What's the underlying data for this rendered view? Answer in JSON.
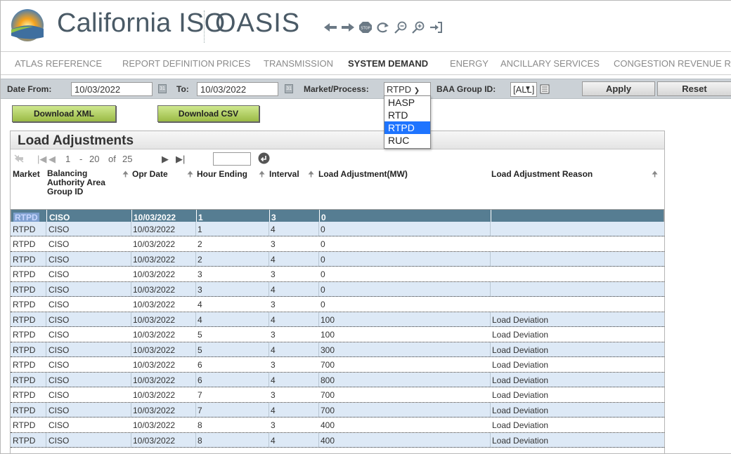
{
  "header": {
    "brand": "California ISO",
    "app": "OASIS",
    "tool_icons": [
      "arrow-left-icon",
      "arrow-right-icon",
      "stop-icon",
      "refresh-icon",
      "zoom-out-icon",
      "zoom-in-icon",
      "logout-icon"
    ]
  },
  "nav": {
    "items": [
      {
        "label": "ATLAS REFERENCE",
        "active": false
      },
      {
        "label": "REPORT DEFINITION",
        "active": false
      },
      {
        "label": "PRICES",
        "active": false
      },
      {
        "label": "TRANSMISSION",
        "active": false
      },
      {
        "label": "SYSTEM DEMAND",
        "active": true
      },
      {
        "label": "ENERGY",
        "active": false
      },
      {
        "label": "ANCILLARY SERVICES",
        "active": false
      },
      {
        "label": "CONGESTION REVENUE RI",
        "active": false
      }
    ]
  },
  "filter": {
    "date_from_label": "Date From:",
    "date_from_value": "10/03/2022",
    "to_label": "To:",
    "to_value": "10/03/2022",
    "market_label": "Market/Process:",
    "market_value": "RTPD",
    "baa_label": "BAA Group ID:",
    "baa_value": "[ALL]",
    "apply_label": "Apply",
    "reset_label": "Reset"
  },
  "market_options": [
    {
      "label": "HASP",
      "highlighted": false
    },
    {
      "label": "RTD",
      "highlighted": false
    },
    {
      "label": "RTPD",
      "highlighted": true
    },
    {
      "label": "RUC",
      "highlighted": false
    }
  ],
  "download": {
    "xml_label": "Download XML",
    "csv_label": "Download CSV"
  },
  "table": {
    "title": "Load Adjustments",
    "pager": {
      "from": "1",
      "dash": "-",
      "to": "20",
      "of_label": "of",
      "total": "25"
    },
    "columns": {
      "market": "Market",
      "baa": "Balancing Authority Area Group ID",
      "opr_date": "Opr Date",
      "hour_ending": "Hour Ending",
      "interval": "Interval",
      "load_adj": "Load Adjustment(MW)",
      "reason": "Load Adjustment Reason"
    },
    "rows": [
      {
        "market": "RTPD",
        "baa": "CISO",
        "date": "10/03/2022",
        "hour": "1",
        "interval": "3",
        "mw": "0",
        "reason": ""
      },
      {
        "market": "RTPD",
        "baa": "CISO",
        "date": "10/03/2022",
        "hour": "1",
        "interval": "4",
        "mw": "0",
        "reason": ""
      },
      {
        "market": "RTPD",
        "baa": "CISO",
        "date": "10/03/2022",
        "hour": "2",
        "interval": "3",
        "mw": "0",
        "reason": ""
      },
      {
        "market": "RTPD",
        "baa": "CISO",
        "date": "10/03/2022",
        "hour": "2",
        "interval": "4",
        "mw": "0",
        "reason": ""
      },
      {
        "market": "RTPD",
        "baa": "CISO",
        "date": "10/03/2022",
        "hour": "3",
        "interval": "3",
        "mw": "0",
        "reason": ""
      },
      {
        "market": "RTPD",
        "baa": "CISO",
        "date": "10/03/2022",
        "hour": "3",
        "interval": "4",
        "mw": "0",
        "reason": ""
      },
      {
        "market": "RTPD",
        "baa": "CISO",
        "date": "10/03/2022",
        "hour": "4",
        "interval": "3",
        "mw": "0",
        "reason": ""
      },
      {
        "market": "RTPD",
        "baa": "CISO",
        "date": "10/03/2022",
        "hour": "4",
        "interval": "4",
        "mw": "100",
        "reason": "Load Deviation"
      },
      {
        "market": "RTPD",
        "baa": "CISO",
        "date": "10/03/2022",
        "hour": "5",
        "interval": "3",
        "mw": "100",
        "reason": "Load Deviation"
      },
      {
        "market": "RTPD",
        "baa": "CISO",
        "date": "10/03/2022",
        "hour": "5",
        "interval": "4",
        "mw": "300",
        "reason": "Load Deviation"
      },
      {
        "market": "RTPD",
        "baa": "CISO",
        "date": "10/03/2022",
        "hour": "6",
        "interval": "3",
        "mw": "700",
        "reason": "Load Deviation"
      },
      {
        "market": "RTPD",
        "baa": "CISO",
        "date": "10/03/2022",
        "hour": "6",
        "interval": "4",
        "mw": "800",
        "reason": "Load Deviation"
      },
      {
        "market": "RTPD",
        "baa": "CISO",
        "date": "10/03/2022",
        "hour": "7",
        "interval": "3",
        "mw": "700",
        "reason": "Load Deviation"
      },
      {
        "market": "RTPD",
        "baa": "CISO",
        "date": "10/03/2022",
        "hour": "7",
        "interval": "4",
        "mw": "700",
        "reason": "Load Deviation"
      },
      {
        "market": "RTPD",
        "baa": "CISO",
        "date": "10/03/2022",
        "hour": "8",
        "interval": "3",
        "mw": "400",
        "reason": "Load Deviation"
      },
      {
        "market": "RTPD",
        "baa": "CISO",
        "date": "10/03/2022",
        "hour": "8",
        "interval": "4",
        "mw": "400",
        "reason": "Load Deviation"
      }
    ]
  }
}
